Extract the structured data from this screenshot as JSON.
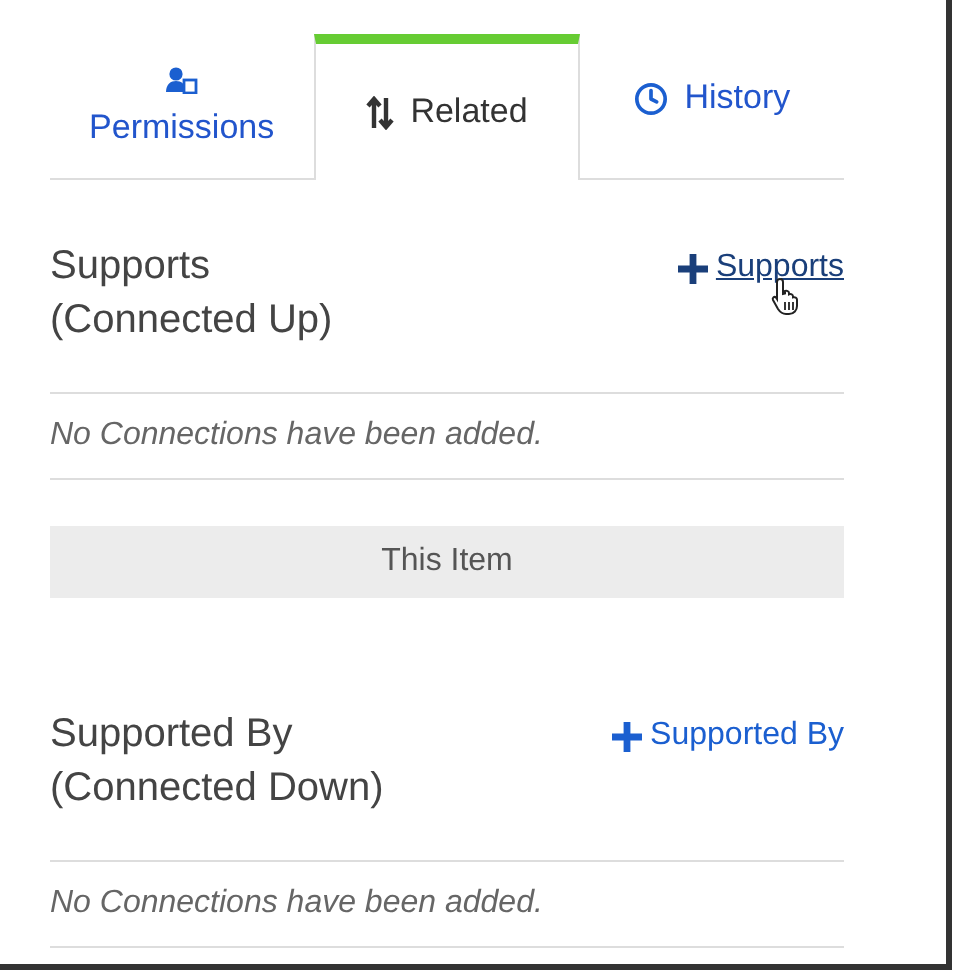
{
  "tabs": [
    {
      "label": "Permissions",
      "kind": "user",
      "selected": false
    },
    {
      "label": "Related",
      "kind": "sort",
      "selected": true
    },
    {
      "label": "History",
      "kind": "clock",
      "selected": false
    }
  ],
  "blocks": [
    {
      "kind": "section",
      "title": "Supports",
      "subtitle": "(Connected Up)",
      "link": "Supports",
      "hovered": true,
      "empty": "No Connections have been added."
    },
    {
      "kind": "marker",
      "label": "This Item"
    },
    {
      "kind": "section",
      "title": "Supported By",
      "subtitle": "(Connected Down)",
      "link": "Supported By",
      "hovered": false,
      "empty": "No Connections have been added."
    }
  ]
}
